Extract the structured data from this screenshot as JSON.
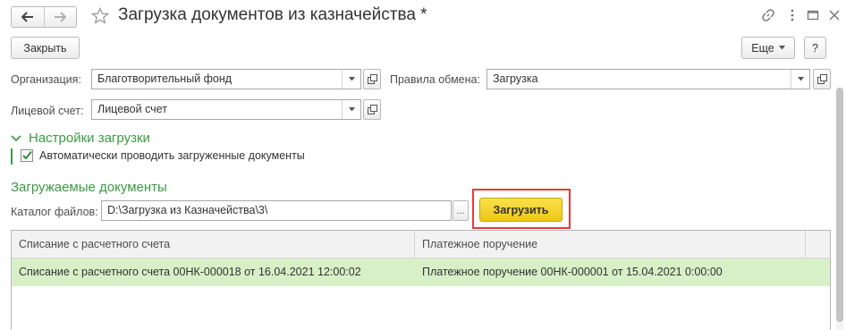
{
  "window": {
    "title": "Загрузка документов из казначейства *"
  },
  "toolbar": {
    "close_label": "Закрыть",
    "more_label": "Еще",
    "help_label": "?"
  },
  "form": {
    "org_label": "Организация:",
    "org_value": "Благотворительный фонд",
    "exchange_label": "Правила обмена:",
    "exchange_value": "Загрузка",
    "account_label": "Лицевой счет:",
    "account_value": "Лицевой счет"
  },
  "settings": {
    "header": "Настройки загрузки",
    "auto_post_label": "Автоматически проводить загруженные документы",
    "auto_post_checked": true
  },
  "documents": {
    "header": "Загружаемые документы",
    "catalog_label": "Каталог файлов:",
    "catalog_value": "D:\\Загрузка из Казначейства\\3\\",
    "browse_label": "...",
    "load_label": "Загрузить"
  },
  "table": {
    "columns": [
      "Списание с расчетного счета",
      "Платежное поручение"
    ],
    "rows": [
      [
        "Списание с расчетного счета 00НК-000018 от 16.04.2021 12:00:02",
        "Платежное поручение 00НК-000001 от 15.04.2021 0:00:00"
      ]
    ]
  },
  "colors": {
    "accent_green": "#3b9a43",
    "highlight_red": "#e8393c",
    "load_button": "#f5d41f",
    "selected_row": "#d7f0c7"
  },
  "icons": [
    "back-arrow-icon",
    "forward-arrow-icon",
    "star-icon",
    "link-icon",
    "menu-dots-icon",
    "maximize-icon",
    "close-icon",
    "chevron-down-icon",
    "open-form-icon",
    "checkbox-checked-icon"
  ]
}
